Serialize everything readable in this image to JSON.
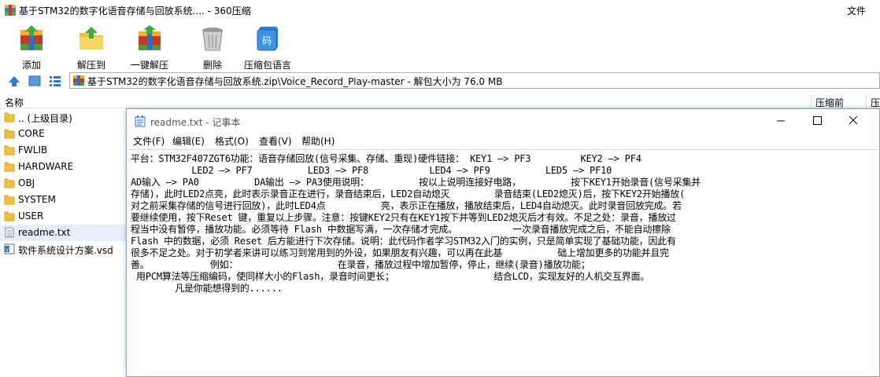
{
  "window": {
    "title": "基于STM32的数字化语音存储与回放系统.... - 360压缩",
    "file_menu": "文件"
  },
  "toolbar": {
    "add": "添加",
    "extract_to": "解压到",
    "one_click_extract": "一键解压",
    "delete": "删除",
    "compress_text": "压缩包语言"
  },
  "address": {
    "path": "基于STM32的数字化语音存储与回放系统.zip\\Voice_Record_Play-master - 解包大小为 76.0 MB"
  },
  "columns": {
    "name": "名称",
    "compressed": "压缩前",
    "ratio": "压"
  },
  "files": [
    {
      "name": ".. (上级目录)",
      "type": "folder"
    },
    {
      "name": "CORE",
      "type": "folder"
    },
    {
      "name": "FWLIB",
      "type": "folder"
    },
    {
      "name": "HARDWARE",
      "type": "folder"
    },
    {
      "name": "OBJ",
      "type": "folder"
    },
    {
      "name": "SYSTEM",
      "type": "folder"
    },
    {
      "name": "USER",
      "type": "folder"
    },
    {
      "name": "readme.txt",
      "type": "txt"
    },
    {
      "name": "软件系统设计方案.vsd",
      "type": "vsd"
    }
  ],
  "notepad": {
    "title": "readme.txt - 记事本",
    "menu": {
      "file": "文件(F)",
      "edit": "编辑(E)",
      "format": "格式(O)",
      "view": "查看(V)",
      "help": "帮助(H)"
    },
    "lines": [
      "平台：STM32F407ZGT6功能：语音存储回放(信号采集、存储、重现)硬件链接： KEY1 —> PF3         KEY2 —> PF4",
      "           LED2 —> PF7          LED3 —> PF8           LED4 —> PF9          LED5 —> PF10",
      "AD输入 —> PA0          DA输出 —> PA3使用说明：         按以上说明连接好电路，         按下KEY1开始录音(信号采集并",
      "存储)，此时LED2点亮，此时表示录音正在进行，录音结束后，LED2自动熄灭        录音结束(LED2熄灭)后，按下KEY2开始播放(",
      "对之前采集存储的信号进行回放)，此时LED4点          亮，表示正在播放，播放结束后，LED4自动熄灭。此时录音回放完成。若",
      "要继续使用，按下Reset 键，重复以上步骤。注意：按键KEY2只有在KEY1按下并等到LED2熄灭后才有效。不足之处：录音，播放过",
      "程当中没有暂停，播放功能。必须等待 Flash 中数据写满，一次存储才完成。          一次录音播放完成之后，不能自动擦除",
      "Flash 中的数据，必须 Reset 后方能进行下次存储。说明：此代码作者学习STM32入门的实例，只是简单实现了基础功能，因此有",
      "很多不足之处。对于初学者来讲可以练习到常用到的外设，如果朋友有兴趣，可以再在此基          础上增加更多的功能并且完",
      "善。           例如：                  在录音，播放过程中增加暂停，停止，继续(录音)播放功能；",
      " 用PCM算法等压缩编码，使同样大小的Flash，录音时间更长；                  结合LCD，实现友好的人机交互界面。",
      "        凡是你能想得到的......"
    ]
  }
}
